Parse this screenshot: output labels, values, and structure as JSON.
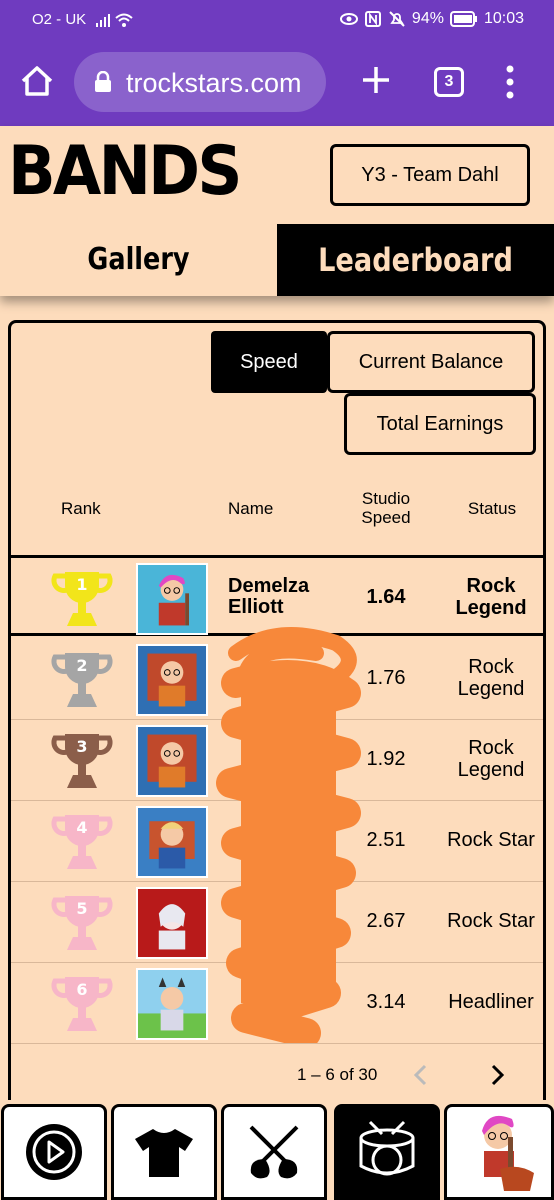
{
  "status_bar": {
    "carrier": "O2 - UK",
    "battery": "94%",
    "time": "10:03"
  },
  "browser": {
    "url": "trockstars.com",
    "tab_count": "3"
  },
  "header": {
    "title": "BANDS",
    "team_button": "Y3 - Team Dahl"
  },
  "tabs": [
    {
      "label": "Gallery",
      "active": false
    },
    {
      "label": "Leaderboard",
      "active": true
    }
  ],
  "sort_buttons": {
    "speed": "Speed",
    "balance": "Current Balance",
    "earnings": "Total Earnings"
  },
  "columns": {
    "rank": "Rank",
    "name": "Name",
    "speed": "Studio Speed",
    "status": "Status"
  },
  "rows": [
    {
      "rank": "1",
      "name": "Demelza Elliott",
      "speed": "1.64",
      "status": "Rock Legend",
      "trophy_color": "#f2e51a"
    },
    {
      "rank": "2",
      "name": "",
      "speed": "1.76",
      "status": "Rock Legend",
      "trophy_color": "#a5a5a5"
    },
    {
      "rank": "3",
      "name": "",
      "speed": "1.92",
      "status": "Rock Legend",
      "trophy_color": "#8b5e4a"
    },
    {
      "rank": "4",
      "name": "",
      "speed": "2.51",
      "status": "Rock Star",
      "trophy_color": "#f7b6c8"
    },
    {
      "rank": "5",
      "name": "",
      "speed": "2.67",
      "status": "Rock Star",
      "trophy_color": "#f7b6c8"
    },
    {
      "rank": "6",
      "name": "",
      "speed": "3.14",
      "status": "Headliner",
      "trophy_color": "#f7b6c8"
    }
  ],
  "pagination": {
    "text": "1 – 6 of 30"
  },
  "bottom_nav": [
    {
      "icon": "play-icon"
    },
    {
      "icon": "tshirt-icon"
    },
    {
      "icon": "guitars-icon"
    },
    {
      "icon": "drum-icon",
      "active": true
    },
    {
      "icon": "avatar-icon"
    }
  ],
  "colors": {
    "browser": "#6f3bbf",
    "background": "#fddcbc",
    "scribble": "#f7883a"
  }
}
